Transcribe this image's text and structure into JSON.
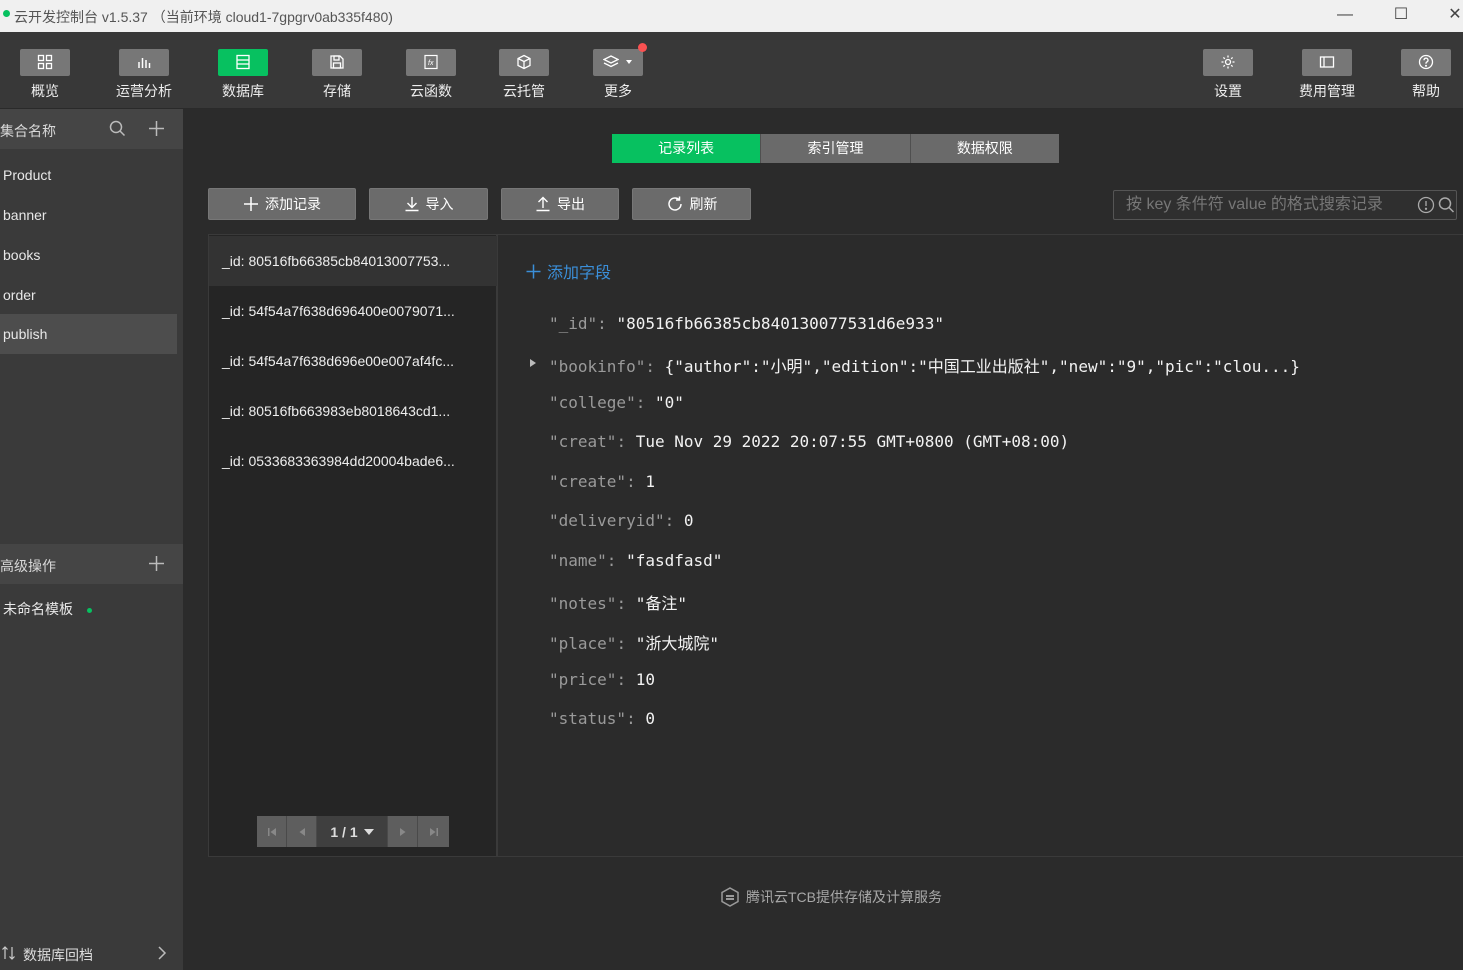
{
  "window": {
    "title": "云开发控制台 v1.5.37 （当前环境 cloud1-7gpgrv0ab335f480)",
    "minimize": "—",
    "maximize": "☐",
    "close": "✕"
  },
  "toolbar": {
    "left": [
      {
        "label": "概览",
        "icon": "grid-icon"
      },
      {
        "label": "运营分析",
        "icon": "bar-chart-icon"
      },
      {
        "label": "数据库",
        "icon": "database-icon"
      },
      {
        "label": "存储",
        "icon": "save-icon"
      },
      {
        "label": "云函数",
        "icon": "function-icon"
      },
      {
        "label": "云托管",
        "icon": "cube-icon"
      },
      {
        "label": "更多",
        "icon": "layers-icon"
      }
    ],
    "right": [
      {
        "label": "设置",
        "icon": "gear-icon"
      },
      {
        "label": "费用管理",
        "icon": "billing-icon"
      },
      {
        "label": "帮助",
        "icon": "help-icon"
      }
    ],
    "active_index": 2
  },
  "sidebar": {
    "collections_header": "集合名称",
    "collections": [
      "Product",
      "banner",
      "books",
      "order",
      "publish"
    ],
    "selected_collection": "publish",
    "advanced_header": "高级操作",
    "templates": [
      "未命名模板"
    ],
    "footer": "数据库回档"
  },
  "tabs": [
    "记录列表",
    "索引管理",
    "数据权限"
  ],
  "actions": {
    "add_record": "添加记录",
    "import": "导入",
    "export": "导出",
    "refresh": "刷新"
  },
  "search": {
    "placeholder": "按 key 条件符 value 的格式搜索记录"
  },
  "records": [
    "_id: 80516fb66385cb84013007753...",
    "_id: 54f54a7f638d696400e0079071...",
    "_id: 54f54a7f638d696e00e007af4fc...",
    "_id: 80516fb663983eb8018643cd1...",
    "_id: 0533683363984dd20004bade6..."
  ],
  "pager": {
    "text": "1 / 1"
  },
  "detail": {
    "add_field": "添加字段",
    "fields": [
      {
        "key": "\"_id\"",
        "value": "\"80516fb66385cb840130077531d6e933\""
      },
      {
        "key": "\"bookinfo\"",
        "value": "{\"author\":\"小明\",\"edition\":\"中国工业出版社\",\"new\":\"9\",\"pic\":\"clou...}"
      },
      {
        "key": "\"college\"",
        "value": "\"0\""
      },
      {
        "key": "\"creat\"",
        "value": "Tue Nov 29 2022 20:07:55 GMT+0800 (GMT+08:00)"
      },
      {
        "key": "\"create\"",
        "value": "1"
      },
      {
        "key": "\"deliveryid\"",
        "value": "0"
      },
      {
        "key": "\"name\"",
        "value": "\"fasdfasd\""
      },
      {
        "key": "\"notes\"",
        "value": "\"备注\""
      },
      {
        "key": "\"place\"",
        "value": "\"浙大城院\""
      },
      {
        "key": "\"price\"",
        "value": "10"
      },
      {
        "key": "\"status\"",
        "value": "0"
      }
    ]
  },
  "footer": "腾讯云TCB提供存储及计算服务",
  "colors": {
    "accent": "#07c160",
    "link": "#3b8fd9",
    "badge": "#fa5151"
  }
}
